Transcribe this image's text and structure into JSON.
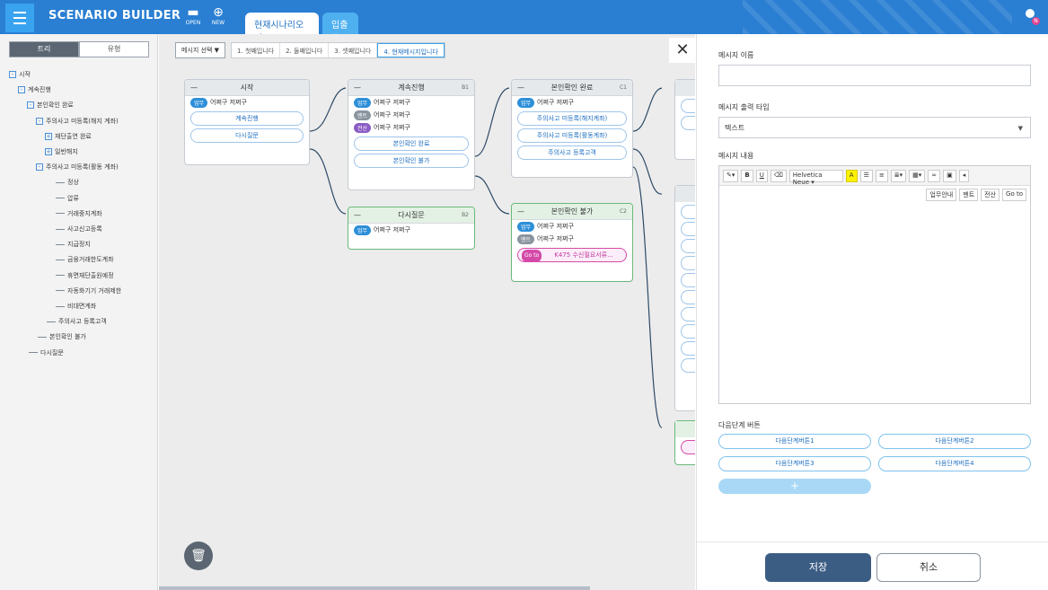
{
  "app": {
    "title": "SCENARIO BUILDER"
  },
  "toolbar": {
    "open_label": "OPEN",
    "new_label": "NEW"
  },
  "tabs": [
    {
      "label": "현재시나리오명"
    },
    {
      "label": "입출금"
    }
  ],
  "left_panel": {
    "tabs": [
      "트리",
      "유형"
    ],
    "tree": [
      {
        "label": "시작",
        "box": "-"
      },
      {
        "label": "계속진행",
        "box": "-"
      },
      {
        "label": "본인확인 완료",
        "box": "-"
      },
      {
        "label": "주의사고 미등록(해지 계좌)",
        "box": "-"
      },
      {
        "label": "재단출연 완료",
        "box": "+"
      },
      {
        "label": "일반해지",
        "box": "+"
      },
      {
        "label": "주의사고 미등록(활동 계좌)",
        "box": "-"
      },
      {
        "label": "정상",
        "box": ""
      },
      {
        "label": "압류",
        "box": ""
      },
      {
        "label": "거래중지계좌",
        "box": ""
      },
      {
        "label": "사고신고등록",
        "box": ""
      },
      {
        "label": "지급정지",
        "box": ""
      },
      {
        "label": "금융거래한도계좌",
        "box": ""
      },
      {
        "label": "휴면재단출원예정",
        "box": ""
      },
      {
        "label": "자동화기기 거래제한",
        "box": ""
      },
      {
        "label": "비대면계좌",
        "box": ""
      },
      {
        "label": "주의사고 등록고객",
        "box": ""
      },
      {
        "label": "본인확인 불가",
        "box": ""
      },
      {
        "label": "다시질문",
        "box": ""
      }
    ]
  },
  "canvas": {
    "msg_select": "메시지 선택 ▼",
    "crumbs": [
      "1. 첫째입니다",
      "2. 둘째입니다",
      "3. 셋째입니다",
      "4. 현재메시지입니다"
    ],
    "tags": {
      "biz": "업무",
      "hint": "멘트",
      "calc": "전산",
      "goto": "Go to"
    },
    "nodes": {
      "start": {
        "title": "시작",
        "code": "",
        "msg": "어쩌구 저쩌구",
        "buttons": [
          "계속진행",
          "다시질문"
        ]
      },
      "continue": {
        "title": "계속진행",
        "code": "B1",
        "msgs": [
          "어쩌구 저쩌구",
          "어쩌구 저쩌구",
          "어쩌구 저쩌구"
        ],
        "buttons": [
          "본인확인 완료",
          "본인확인 불가"
        ]
      },
      "again": {
        "title": "다시질문",
        "code": "B2",
        "msg": "어쩌구 저쩌구"
      },
      "verified": {
        "title": "본인확인 완료",
        "code": "C1",
        "msg": "어쩌구 저쩌구",
        "buttons": [
          "주의사고 미등록(해지계좌)",
          "주의사고 미등록(활동계좌)",
          "주의사고 등록고객"
        ]
      },
      "unverified": {
        "title": "본인확인 불가",
        "code": "C2",
        "msgs": [
          "어쩌구 저쩌구",
          "어쩌구 저쩌구"
        ],
        "goto": "K475 수신필요서류..."
      }
    },
    "minus": "—"
  },
  "panel": {
    "close": "✕",
    "msg_name_label": "메시지 이름",
    "msg_name_value": "",
    "output_type_label": "메시지 출력 타입",
    "output_type_value": "텍스트",
    "content_label": "메시지 내용",
    "editor_font": "Helvetica Neue ▾",
    "editor_tools2": [
      "업무안내",
      "멘트",
      "전산",
      "Go to"
    ],
    "next_label": "다음단계 버튼",
    "next_buttons": [
      "다음단계버튼1",
      "다음단계버튼2",
      "다음단계버튼3",
      "다음단계버튼4"
    ],
    "add": "+",
    "save": "저장",
    "cancel": "취소"
  },
  "colors": {
    "topbar": "#2a7fd3",
    "accent": "#3aa3f0",
    "save": "#3b5d84",
    "goto": "#d54aa9"
  }
}
